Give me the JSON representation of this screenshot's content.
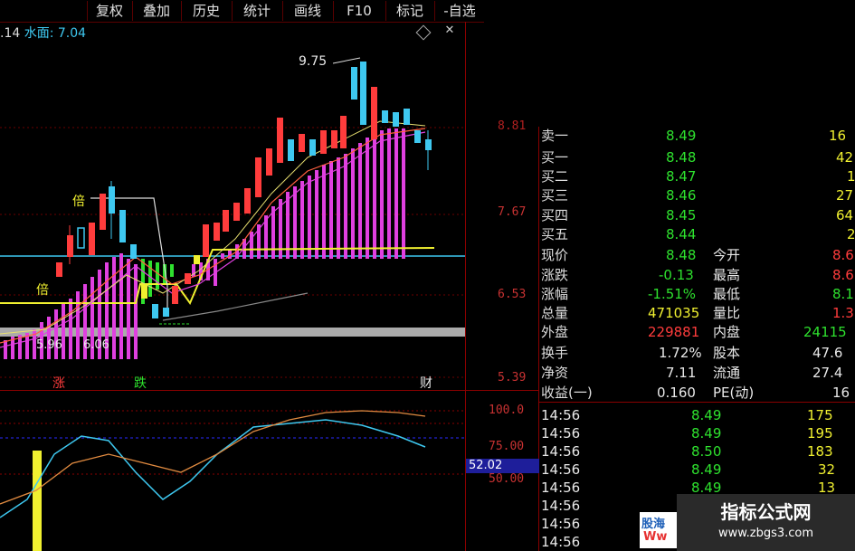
{
  "toolbar": {
    "items": [
      "复权",
      "叠加",
      "历史",
      "统计",
      "画线",
      "F10",
      "标记",
      "-自选"
    ]
  },
  "legend": {
    "left_value": ".14",
    "name": "水面:",
    "value": "7.04"
  },
  "chart": {
    "axis_labels": [
      "8.81",
      "7.67",
      "6.53",
      "5.39"
    ],
    "peak_label": "9.75",
    "low_label": "5.96",
    "low_label2": "6.06",
    "marker_bei": "倍",
    "marker_bei2": "倍",
    "marker_zhang": "涨",
    "marker_die": "跌",
    "marker_cai": "财",
    "colors": {
      "up": "#ff3c3c",
      "down": "#3ec8f0",
      "volume": "#e040e0",
      "yellow": "#f0f030"
    }
  },
  "oscillator": {
    "axis_labels": [
      "100.0",
      "75.00",
      "50.00"
    ],
    "current": "52.02"
  },
  "quote": {
    "rows": [
      {
        "name": "卖一",
        "price": "8.49",
        "vol": "16"
      },
      {
        "name": "买一",
        "price": "8.48",
        "vol": "42"
      },
      {
        "name": "买二",
        "price": "8.47",
        "vol": "1"
      },
      {
        "name": "买三",
        "price": "8.46",
        "vol": "27"
      },
      {
        "name": "买四",
        "price": "8.45",
        "vol": "64"
      },
      {
        "name": "买五",
        "price": "8.44",
        "vol": "2"
      }
    ],
    "stats": [
      {
        "l": "现价",
        "lv": "8.48",
        "r": "今开",
        "rv": "8.6"
      },
      {
        "l": "涨跌",
        "lv": "-0.13",
        "r": "最高",
        "rv": "8.6"
      },
      {
        "l": "涨幅",
        "lv": "-1.51%",
        "r": "最低",
        "rv": "8.1"
      },
      {
        "l": "总量",
        "lv": "471035",
        "r": "量比",
        "rv": "1.3"
      },
      {
        "l": "外盘",
        "lv": "229881",
        "r": "内盘",
        "rv": "24115"
      },
      {
        "l": "换手",
        "lv": "1.72%",
        "r": "股本",
        "rv": "47.6"
      },
      {
        "l": "净资",
        "lv": "7.11",
        "r": "流通",
        "rv": "27.4"
      },
      {
        "l": "收益(一)",
        "lv": "0.160",
        "r": "PE(动)",
        "rv": "16"
      }
    ]
  },
  "ticks": [
    {
      "t": "14:56",
      "p": "8.49",
      "v": "175"
    },
    {
      "t": "14:56",
      "p": "8.49",
      "v": "195"
    },
    {
      "t": "14:56",
      "p": "8.50",
      "v": "183"
    },
    {
      "t": "14:56",
      "p": "8.49",
      "v": "32"
    },
    {
      "t": "14:56",
      "p": "8.49",
      "v": "13"
    },
    {
      "t": "14:56",
      "p": "",
      "v": ""
    },
    {
      "t": "14:56",
      "p": "",
      "v": ""
    },
    {
      "t": "14:56",
      "p": "",
      "v": ""
    }
  ],
  "watermark": {
    "title": "指标公式网",
    "url": "www.zbgs3.com",
    "logo_top": "股海",
    "logo_bottom": "Ww"
  }
}
